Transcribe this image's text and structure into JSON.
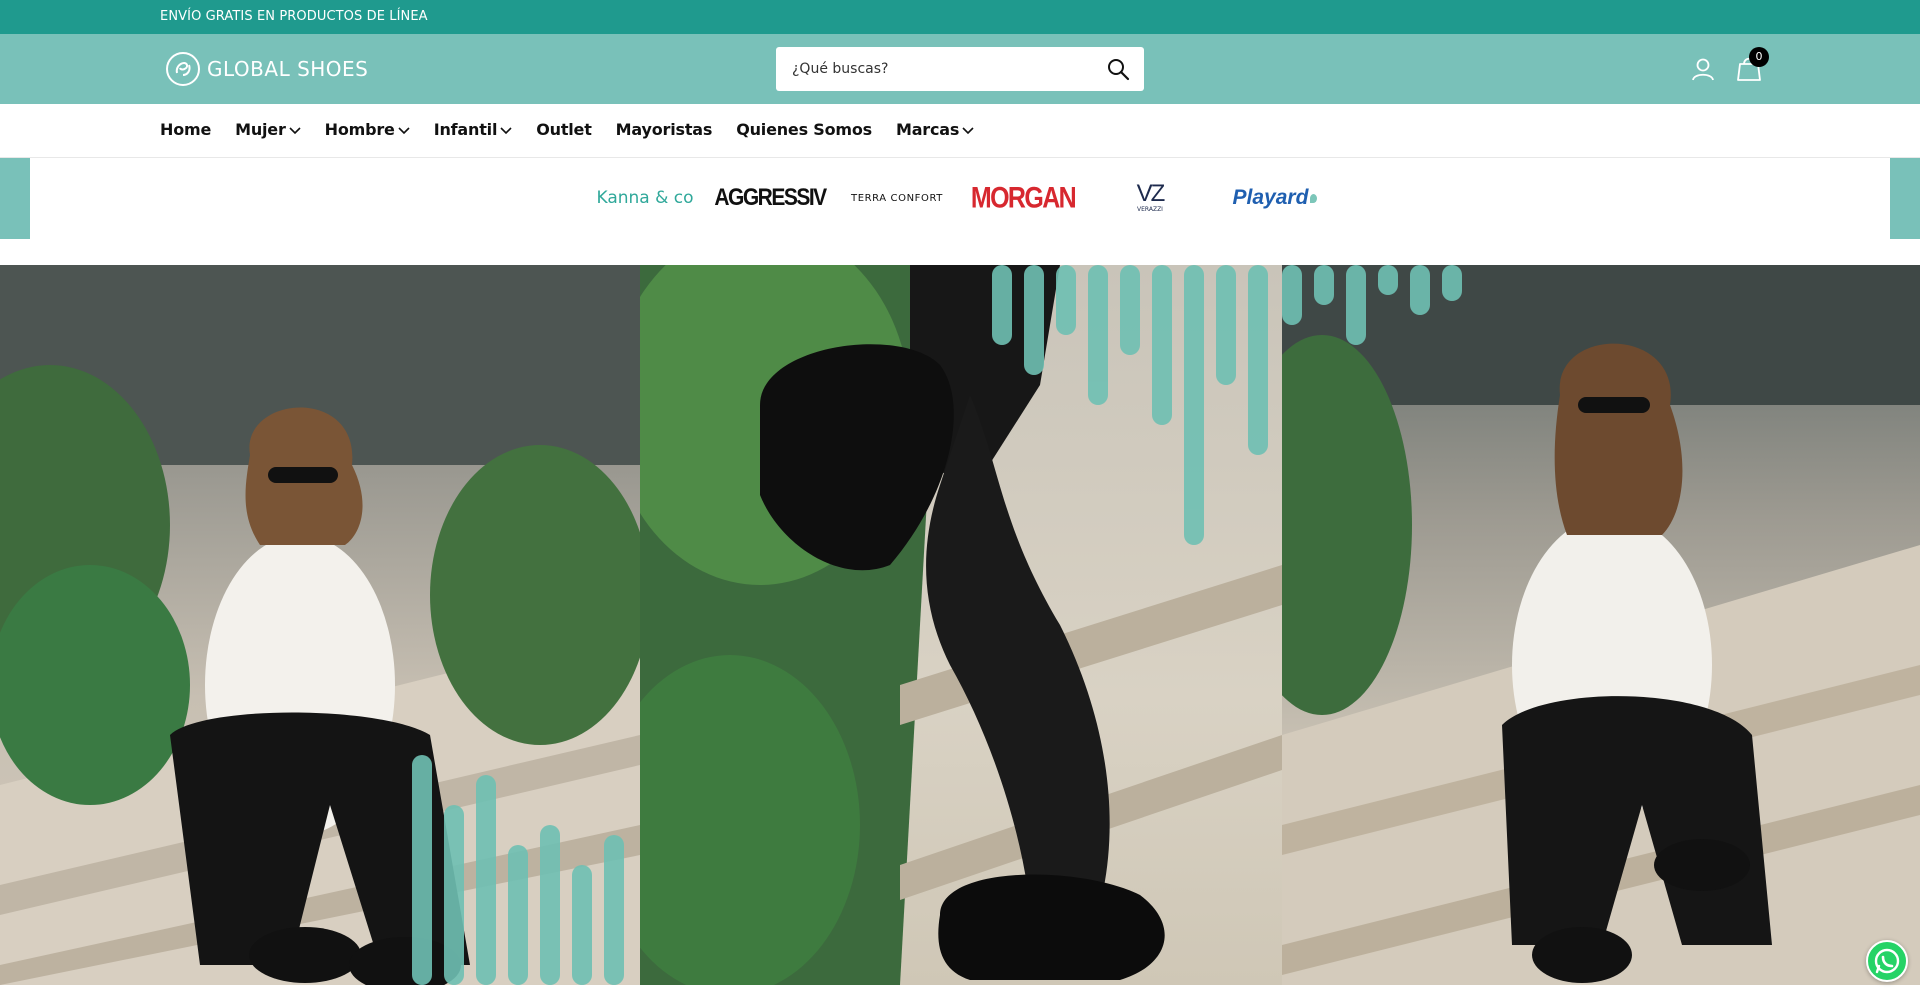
{
  "announcement": {
    "text": "ENVÍO GRATIS EN PRODUCTOS DE LÍNEA"
  },
  "header": {
    "logo_text": "GLOBAL SHOES",
    "search_placeholder": "¿Qué buscas?",
    "cart_count": "0"
  },
  "nav": {
    "items": [
      {
        "label": "Home",
        "has_dropdown": false
      },
      {
        "label": "Mujer",
        "has_dropdown": true
      },
      {
        "label": "Hombre",
        "has_dropdown": true
      },
      {
        "label": "Infantil",
        "has_dropdown": true
      },
      {
        "label": "Outlet",
        "has_dropdown": false
      },
      {
        "label": "Mayoristas",
        "has_dropdown": false
      },
      {
        "label": "Quienes Somos",
        "has_dropdown": false
      },
      {
        "label": "Marcas",
        "has_dropdown": true
      }
    ]
  },
  "brands": {
    "kanna": "Kanna & co",
    "aggressiv": "AGGRESSIV",
    "terra": "TERRA CONFORT",
    "morgan": "MORGAN",
    "verazzi_mark": "VZ",
    "verazzi_name": "VERAZZI",
    "playard": "Playard"
  },
  "hero": {
    "panels": [
      "lifestyle-photo-left",
      "lifestyle-photo-center",
      "lifestyle-photo-right"
    ]
  },
  "colors": {
    "announce_bg": "#1f9a8e",
    "header_bg": "#79c1b9",
    "accent_teal": "#2fa89a",
    "text_dark": "#111111"
  },
  "icons": {
    "search": "search-icon",
    "account": "user-icon",
    "cart": "shopping-bag-icon",
    "dropdown": "chevron-down-icon",
    "whatsapp": "whatsapp-icon"
  }
}
